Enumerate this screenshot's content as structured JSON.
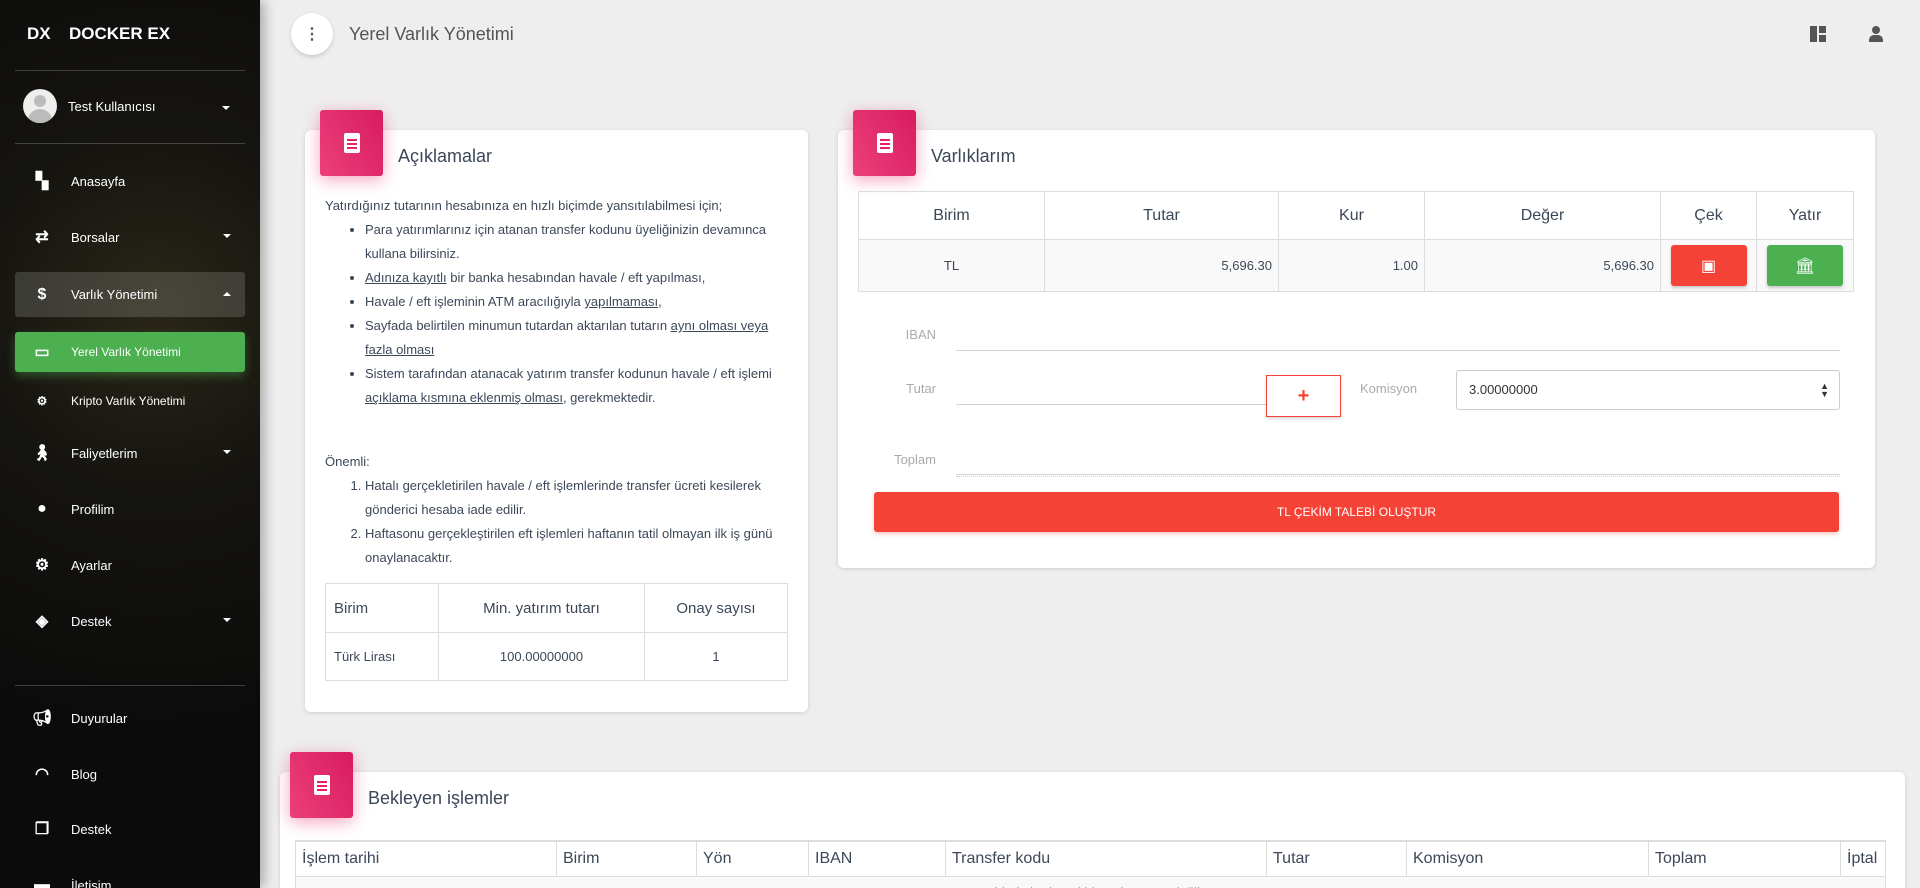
{
  "sidebar": {
    "logo_short": "DX",
    "logo_name": "DOCKER EX",
    "user_name": "Test Kullanıcısı",
    "items": [
      {
        "label": "Anasayfa",
        "icon": "dashboard-icon"
      },
      {
        "label": "Borsalar",
        "icon": "swap-icon"
      },
      {
        "label": "Varlık Yönetimi",
        "icon": "dollar-icon"
      },
      {
        "label": "Yerel Varlık Yönetimi",
        "icon": "money-icon"
      },
      {
        "label": "Kripto Varlık Yönetimi",
        "icon": "chip-icon"
      },
      {
        "label": "Faliyetlerim",
        "icon": "person-icon"
      },
      {
        "label": "Profilim",
        "icon": "user-icon"
      },
      {
        "label": "Ayarlar",
        "icon": "gear-icon"
      },
      {
        "label": "Destek",
        "icon": "ticket-icon"
      },
      {
        "label": "Duyurular",
        "icon": "megaphone-icon"
      },
      {
        "label": "Blog",
        "icon": "rss-icon"
      },
      {
        "label": "Destek",
        "icon": "documents-icon"
      },
      {
        "label": "İletişim",
        "icon": "contact-icon"
      }
    ]
  },
  "header": {
    "title": "Yerel Varlık Yönetimi"
  },
  "info_card": {
    "title": "Açıklamalar",
    "intro": "Yatırdığınız tutarının hesabınıza en hızlı biçimde yansıtılabilmesi için;",
    "b1": "Para yatırımlarınız için atanan transfer kodunu üyeliğinizin devamınca kullana bilirsiniz.",
    "b2_u": "Adınıza kayıtlı",
    "b2": " bir banka hesabından havale / eft yapılması,",
    "b3": "Havale / eft işleminin ATM aracılığıyla ",
    "b3_u": "yapılmaması",
    "b3_end": ",",
    "b4": "Sayfada belirtilen minumun tutardan aktarılan tutarın ",
    "b4_u": "aynı olması veya fazla olması",
    "b5": "Sistem tarafından atanacak yatırım transfer kodunun havale / eft işlemi ",
    "b5_u": "açıklama kısmına eklenmiş olması",
    "b5_end": ", gerekmektedir.",
    "important": "Önemli:",
    "n1": "Hatalı gerçekletirilen havale / eft işlemlerinde transfer ücreti kesilerek gönderici hesaba iade edilir.",
    "n2": "Haftasonu gerçekleştirilen eft işlemleri haftanın tatil olmayan ilk iş günü onaylanacaktır.",
    "table": {
      "headers": [
        "Birim",
        "Min. yatırım tutarı",
        "Onay sayısı"
      ],
      "row": [
        "Türk Lirası",
        "100.00000000",
        "1"
      ]
    }
  },
  "assets_card": {
    "title": "Varlıklarım",
    "table": {
      "headers": [
        "Birim",
        "Tutar",
        "Kur",
        "Değer",
        "Çek",
        "Yatır"
      ],
      "row": [
        "TL",
        "5,696.30",
        "1.00",
        "5,696.30"
      ]
    },
    "form": {
      "iban_label": "IBAN",
      "tutar_label": "Tutar",
      "komisyon_label": "Komisyon",
      "komisyon_value": "3.00000000",
      "toplam_label": "Toplam",
      "submit": "TL ÇEKİM TALEBİ OLUŞTUR"
    }
  },
  "pending_card": {
    "title": "Bekleyen işlemler",
    "headers": [
      "İşlem tarihi",
      "Birim",
      "Yön",
      "IBAN",
      "Transfer kodu",
      "Tutar",
      "Komisyon",
      "Toplam",
      "İptal"
    ],
    "empty": "Tabloda herhangi bir veri mevcut değil"
  },
  "colors": {
    "primary": "#e91e63",
    "success": "#4caf50",
    "danger": "#f44336"
  }
}
